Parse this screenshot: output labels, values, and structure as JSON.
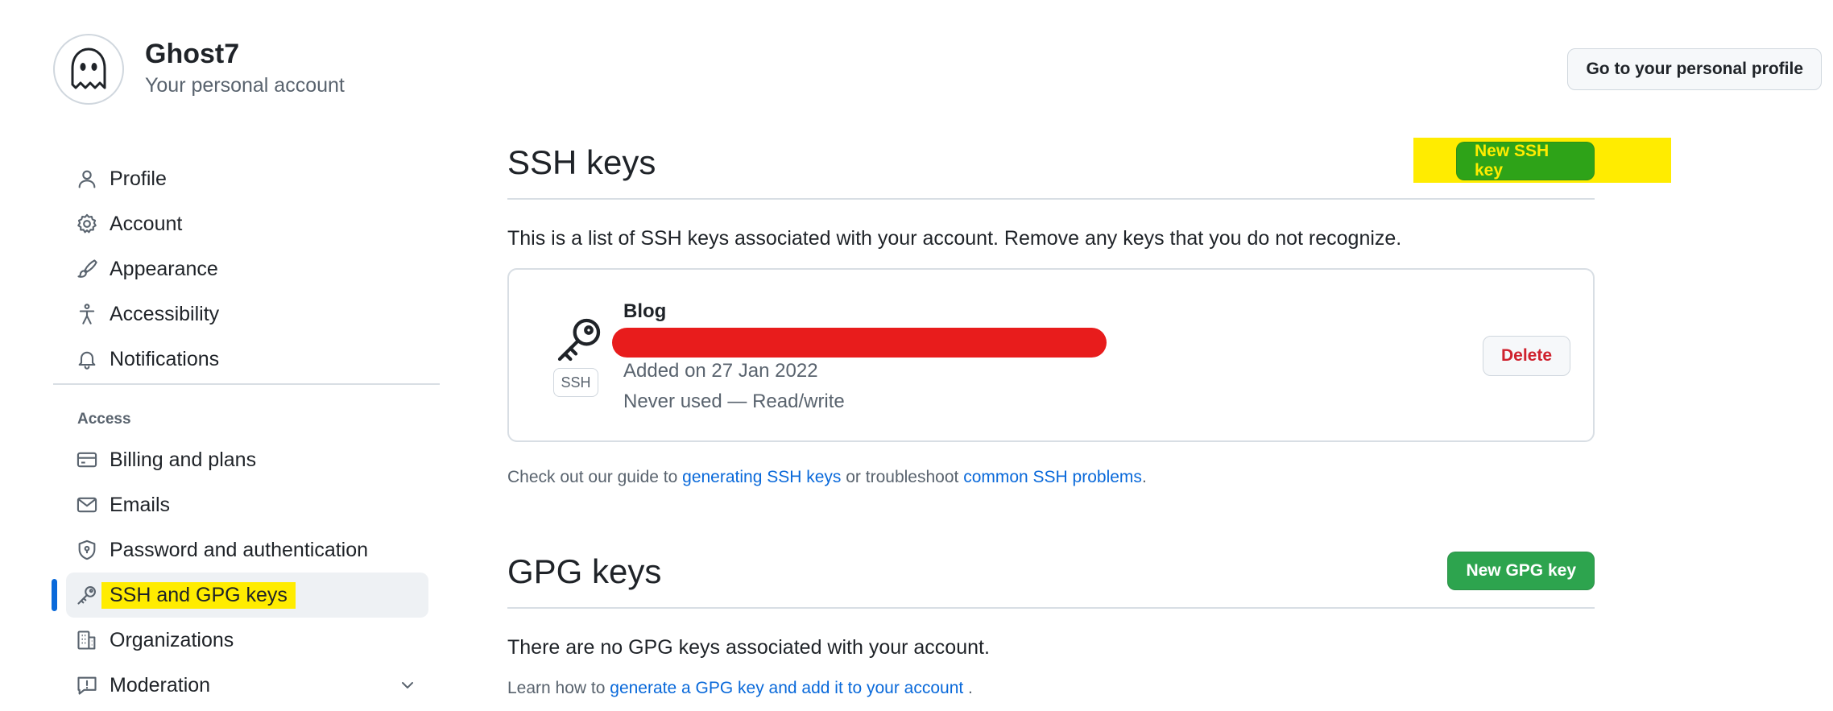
{
  "account": {
    "name": "Ghost7",
    "subtitle": "Your personal account",
    "profile_button": "Go to your personal profile"
  },
  "sidebar": {
    "items": [
      {
        "label": "Profile",
        "icon": "person-icon"
      },
      {
        "label": "Account",
        "icon": "gear-icon"
      },
      {
        "label": "Appearance",
        "icon": "paintbrush-icon"
      },
      {
        "label": "Accessibility",
        "icon": "accessibility-icon"
      },
      {
        "label": "Notifications",
        "icon": "bell-icon"
      }
    ],
    "section_access": "Access",
    "access_items": [
      {
        "label": "Billing and plans",
        "icon": "credit-card-icon"
      },
      {
        "label": "Emails",
        "icon": "mail-icon"
      },
      {
        "label": "Password and authentication",
        "icon": "shield-lock-icon"
      },
      {
        "label": "SSH and GPG keys",
        "icon": "key-icon",
        "active": true
      },
      {
        "label": "Organizations",
        "icon": "organization-icon"
      },
      {
        "label": "Moderation",
        "icon": "report-icon"
      }
    ]
  },
  "ssh": {
    "title": "SSH keys",
    "new_button": "New SSH key",
    "description": "This is a list of SSH keys associated with your account. Remove any keys that you do not recognize.",
    "key": {
      "title": "Blog",
      "badge": "SSH",
      "added": "Added on 27 Jan 2022",
      "usage": "Never used — Read/write",
      "delete_button": "Delete"
    },
    "help_prefix": "Check out our guide to ",
    "help_link1": "generating SSH keys",
    "help_middle": " or troubleshoot ",
    "help_link2": "common SSH problems",
    "help_suffix": "."
  },
  "gpg": {
    "title": "GPG keys",
    "new_button": "New GPG key",
    "description": "There are no GPG keys associated with your account.",
    "help_prefix": "Learn how to ",
    "help_link": "generate a GPG key and add it to your account",
    "help_suffix": " ."
  },
  "colors": {
    "accent_blue": "#0969da",
    "green_button": "#2da44e",
    "highlight_yellow": "#ffec00",
    "redaction_red": "#e81c1c",
    "danger_red": "#cf222e"
  }
}
